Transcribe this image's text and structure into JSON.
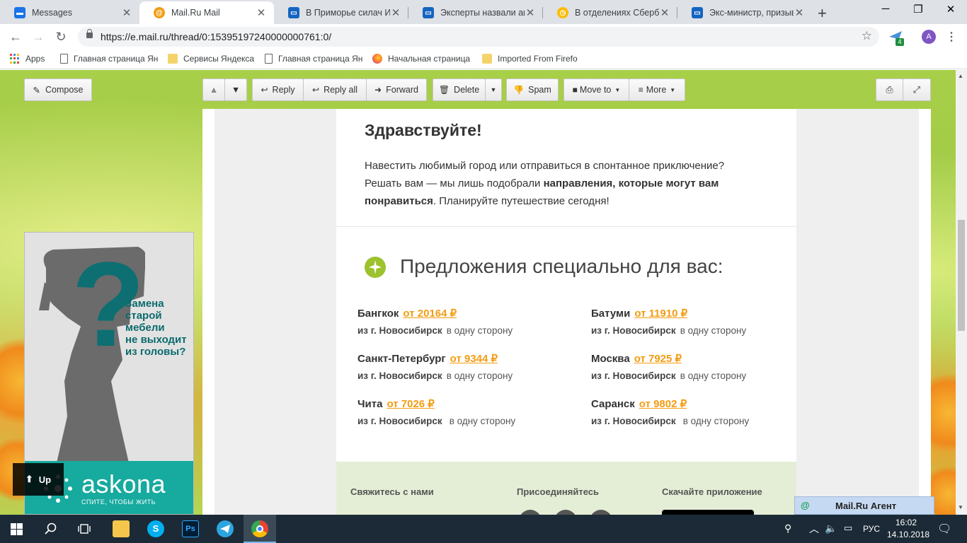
{
  "browser": {
    "tabs": [
      {
        "title": "Messages",
        "active": false,
        "icon": "messages-icon",
        "color": "#1a73e8"
      },
      {
        "title": "Mail.Ru Mail",
        "active": true,
        "icon": "mailru-at-icon",
        "color": "#f39c12"
      },
      {
        "title": "В Приморье силач Ива",
        "active": false,
        "icon": "news-icon",
        "color": "#1565c0"
      },
      {
        "title": "Эксперты назвали авто",
        "active": false,
        "icon": "news-icon",
        "color": "#1565c0"
      },
      {
        "title": "В отделениях Сбербан",
        "active": false,
        "icon": "news-icon",
        "color": "#fbbc04"
      },
      {
        "title": "Экс-министр, призыва",
        "active": false,
        "icon": "news-icon",
        "color": "#1565c0"
      }
    ],
    "tab_close": "✕",
    "new_tab": "+",
    "url": "https://e.mail.ru/thread/0:15395197240000000761:0/",
    "extension_badge": "4",
    "profile_initial": "A",
    "bookmarks": [
      {
        "label": "Apps",
        "icon": "apps-grid-icon"
      },
      {
        "label": "Главная страница Ян",
        "icon": "page-icon"
      },
      {
        "label": "Сервисы Яндекса",
        "icon": "folder-icon"
      },
      {
        "label": "Главная страница Ян",
        "icon": "page-icon"
      },
      {
        "label": "Начальная страница",
        "icon": "firefox-icon"
      },
      {
        "label": "Imported From Firefo",
        "icon": "folder-icon"
      }
    ]
  },
  "mail": {
    "compose_label": "Compose",
    "toolbar": {
      "reply": "Reply",
      "reply_all": "Reply all",
      "forward": "Forward",
      "delete": "Delete",
      "spam": "Spam",
      "move_to": "Move to",
      "more": "More"
    },
    "up_label": "Up",
    "agent_label": "Mail.Ru Агент",
    "agent_icon": "@"
  },
  "letter": {
    "greeting": "Здравствуйте!",
    "intro_part1": "Навестить любимый город или отправиться в спонтанное приключение? Решать вам — мы лишь подобрали ",
    "intro_bold": "направления, которые могут вам понравиться",
    "intro_part2": ". Планируйте путешествие сегодня!",
    "offers_title": "Предложения специально для вас:",
    "offers": [
      {
        "city": "Бангкок",
        "price": "от 20164 ₽",
        "from": "из г. Новосибирск",
        "direction": "в одну сторону"
      },
      {
        "city": "Батуми",
        "price": "от 11910 ₽",
        "from": "из г. Новосибирск",
        "direction": "в одну сторону"
      },
      {
        "city": "Санкт-Петербург",
        "price": "от 9344 ₽",
        "from": "из г. Новосибирск",
        "direction": "в одну сторону"
      },
      {
        "city": "Москва",
        "price": "от 7925 ₽",
        "from": "из г. Новосибирск",
        "direction": "в одну сторону"
      },
      {
        "city": "Чита",
        "price": "от 7026 ₽",
        "from": "из г. Новосибирск",
        "direction": "в одну сторону"
      },
      {
        "city": "Саранск",
        "price": "от 9802 ₽",
        "from": "из г. Новосибирск",
        "direction": "в одну сторону"
      }
    ],
    "footer": {
      "contact": "Свяжитесь с нами",
      "join": "Присоединяйтесь",
      "download": "Скачайте приложение"
    },
    "accent_color": "#f39c12",
    "plane_color": "#9cc22e"
  },
  "ad": {
    "text_lines": [
      "Замена",
      "старой",
      "мебели",
      "не выходит",
      "из головы?"
    ],
    "brand": "askona",
    "slogan": "СПИТЕ, ЧТОБЫ ЖИТЬ",
    "brand_color": "#17aa9e"
  },
  "taskbar": {
    "language": "РУС",
    "time": "16:02",
    "date": "14.10.2018"
  }
}
